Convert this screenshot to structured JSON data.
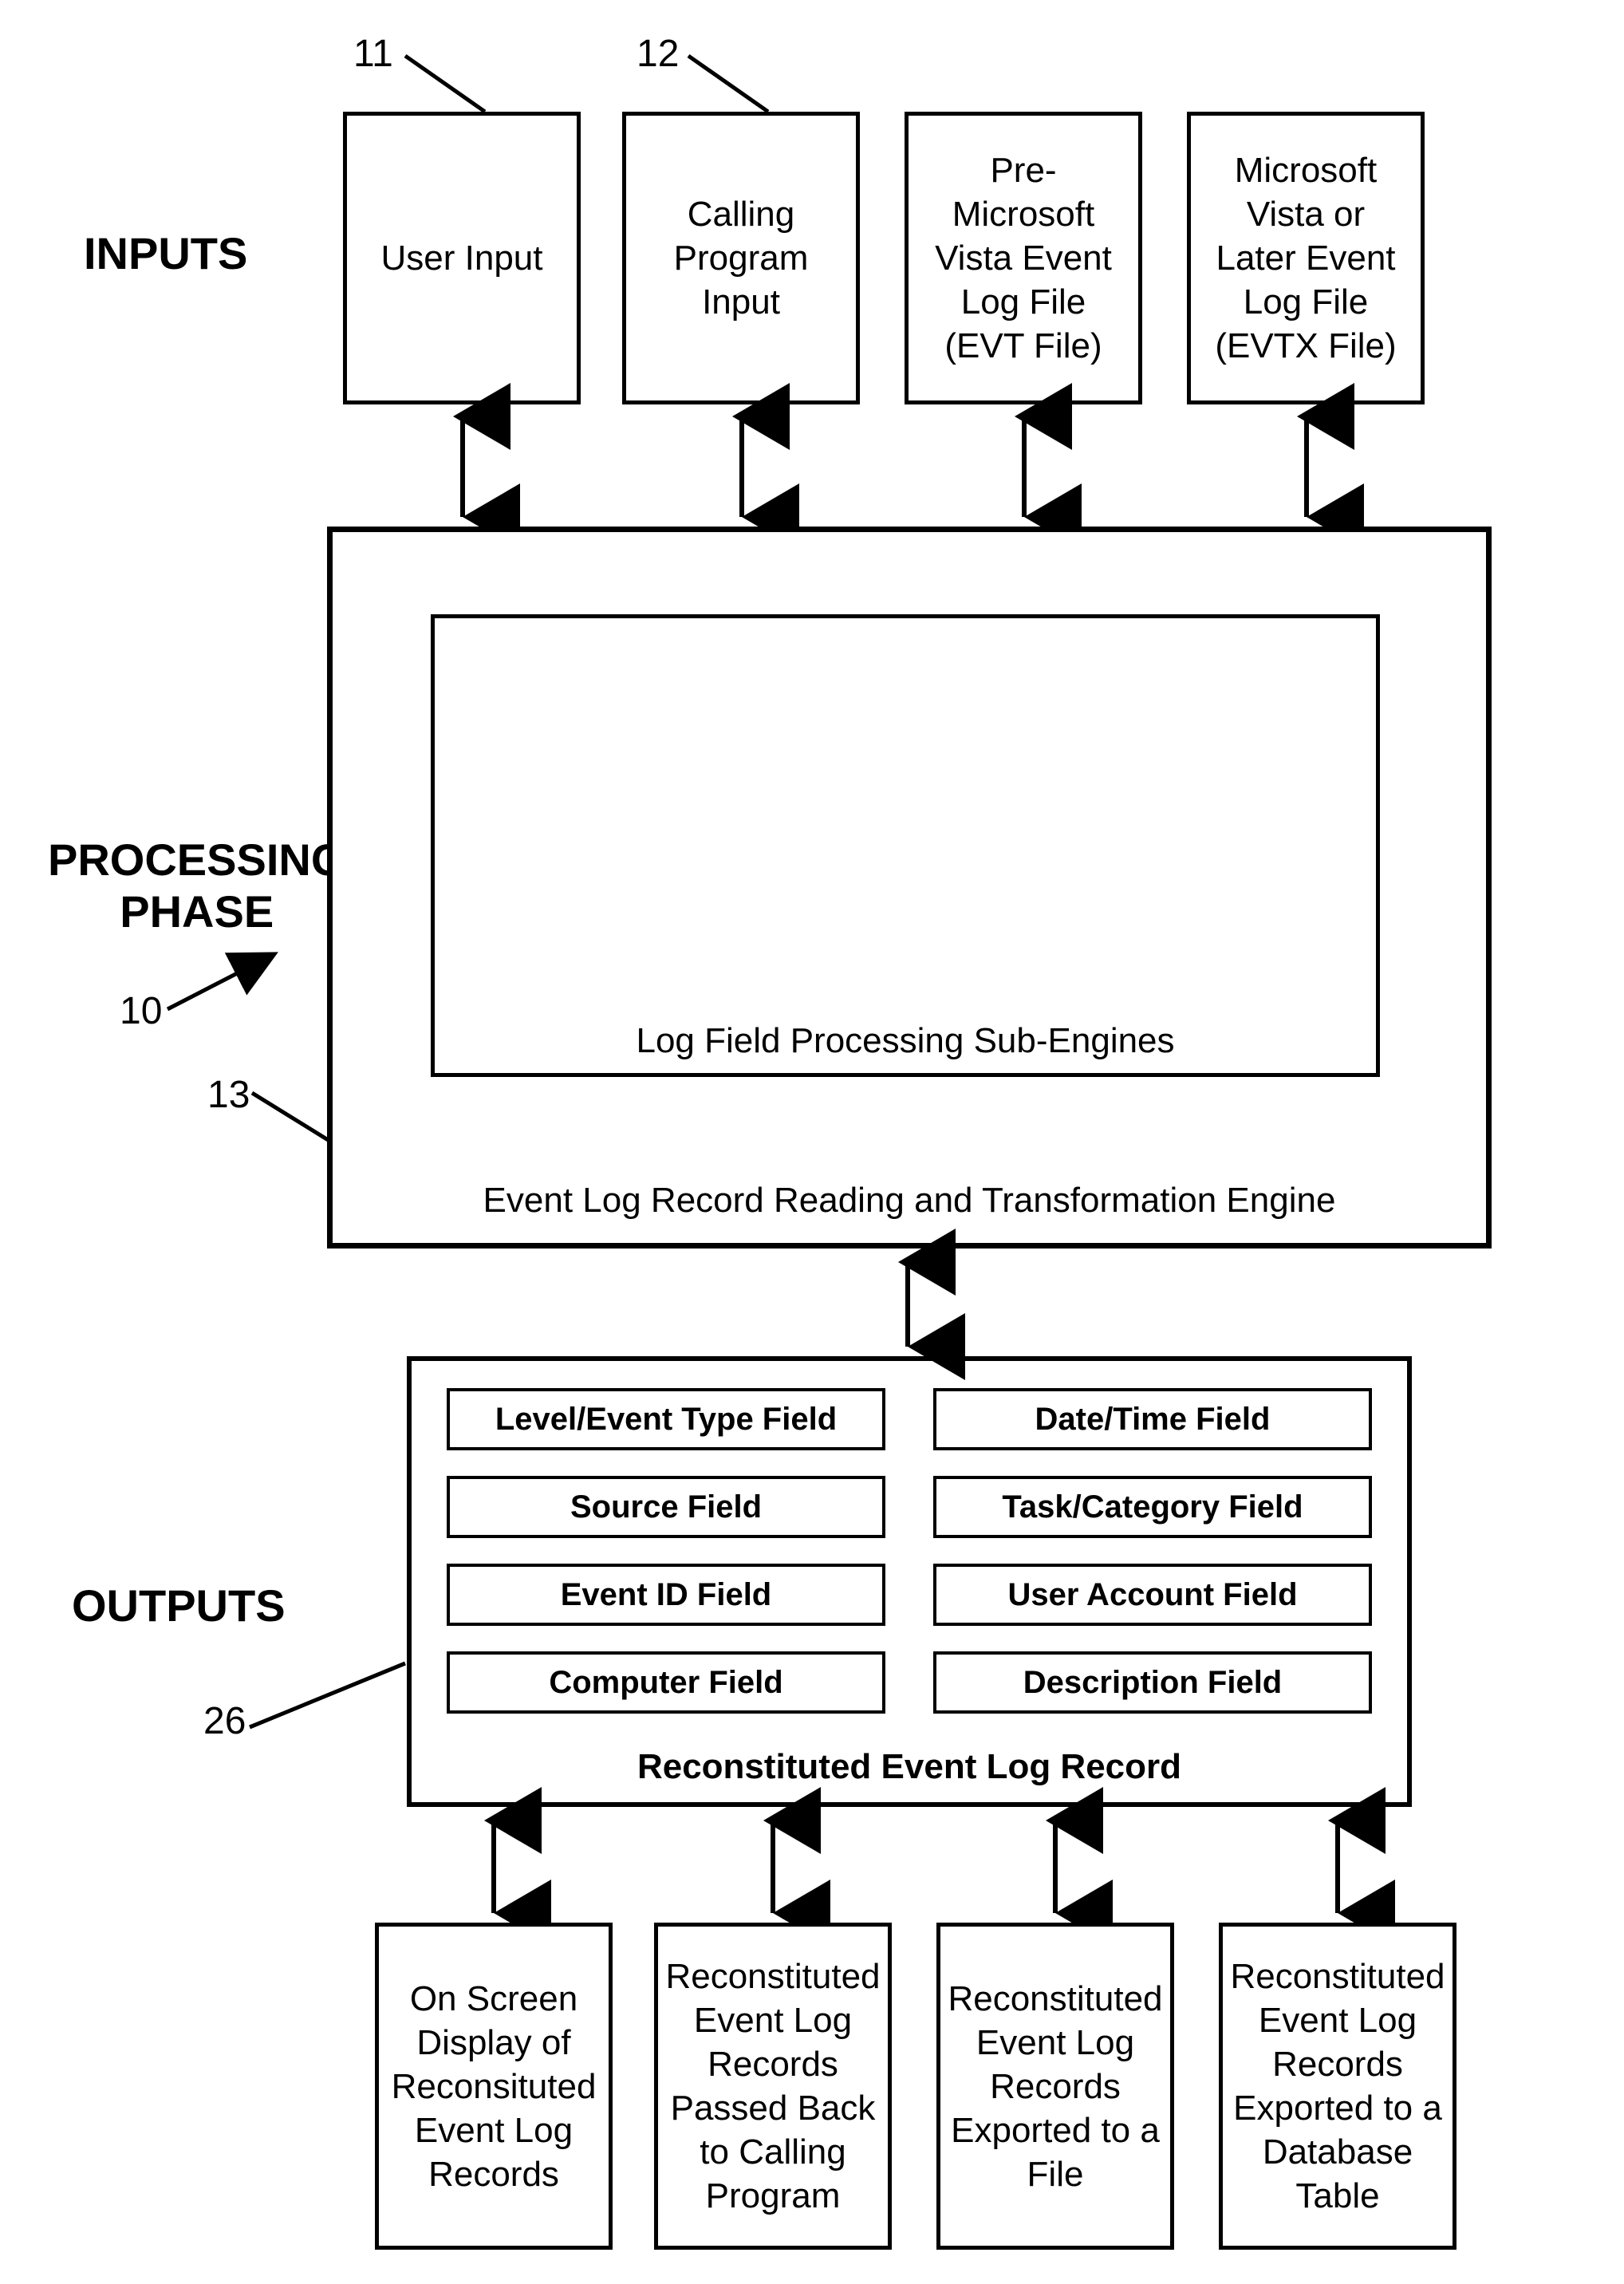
{
  "labels": {
    "inputs": "INPUTS",
    "processing": "PROCESSING\nPHASE",
    "outputs": "OUTPUTS",
    "ref10": "10",
    "ref11": "11",
    "ref12": "12",
    "ref13": "13",
    "ref26": "26"
  },
  "inputs": {
    "b1": "User Input",
    "b2": "Calling Program Input",
    "b3": "Pre-Microsoft Vista Event Log File (EVT File)",
    "b4": "Microsoft Vista or Later Event Log File (EVTX File)"
  },
  "engine": {
    "inner": "Log Field Processing Sub-Engines",
    "caption": "Event Log Record Reading and Transformation Engine"
  },
  "record": {
    "f1": "Level/Event Type Field",
    "f2": "Date/Time Field",
    "f3": "Source Field",
    "f4": "Task/Category Field",
    "f5": "Event ID Field",
    "f6": "User Account Field",
    "f7": "Computer Field",
    "f8": "Description Field",
    "caption": "Reconstituted Event Log Record"
  },
  "outputs": {
    "o1": "On Screen Display of Reconsituted Event Log Records",
    "o2": "Reconstituted Event Log Records Passed Back to Calling Program",
    "o3": "Reconstituted Event Log Records Exported to a File",
    "o4": "Reconstituted Event Log Records Exported to a Database Table"
  }
}
